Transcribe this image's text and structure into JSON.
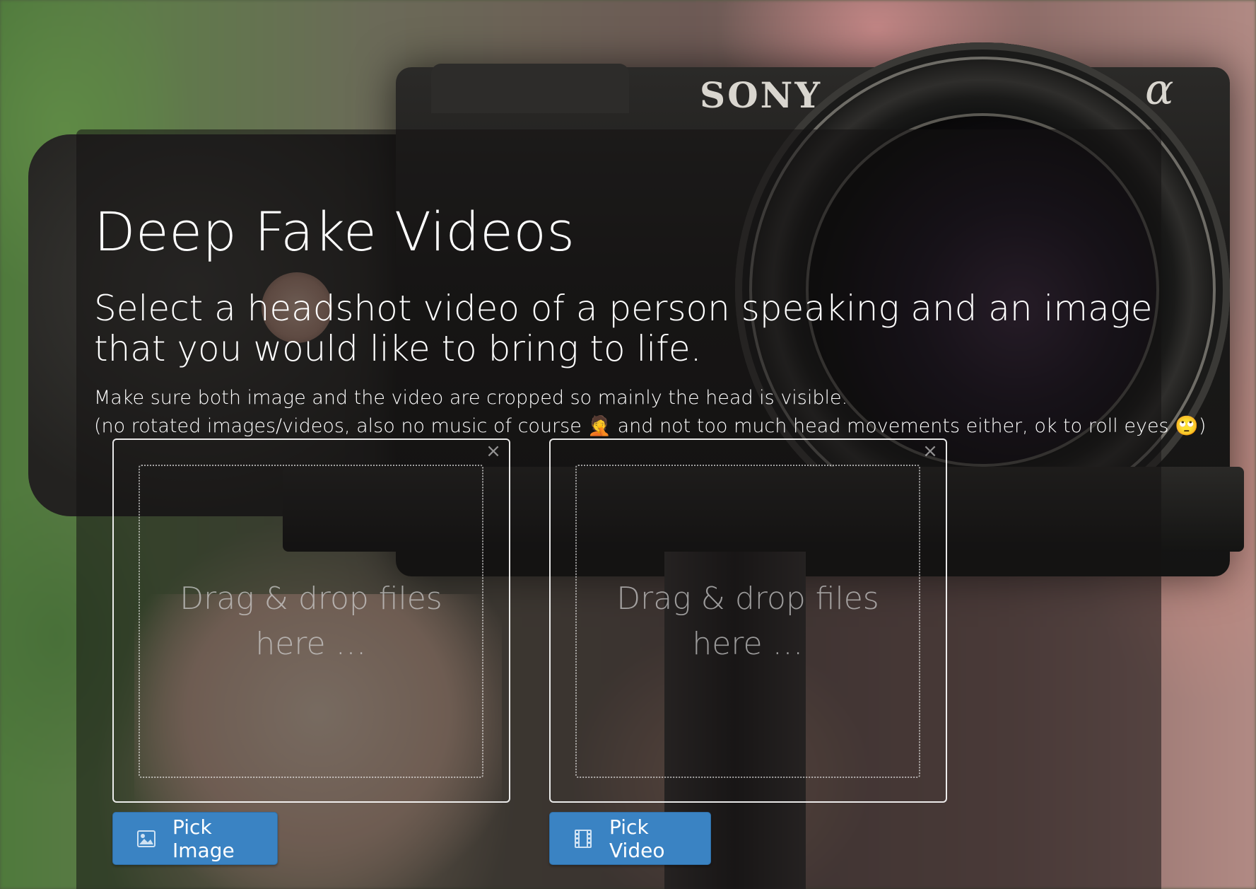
{
  "header": {
    "title": "Deep Fake Videos",
    "subtitle": "Select a headshot video of a person speaking and an image that you would like to bring to life.",
    "note_line1": "Make sure both image and the video are cropped so mainly the head is visible.",
    "note_line2_a": "(no rotated images/videos, also no music of course ",
    "note_line2_emoji1": "🤦",
    "note_line2_b": " and not too much head movements either, ok to roll eyes ",
    "note_line2_emoji2": "🙄",
    "note_line2_c": ")"
  },
  "background": {
    "brand_text": "SONY",
    "alpha_text": "α"
  },
  "image_upload": {
    "drop_text": "Drag & drop files here …",
    "close_glyph": "×",
    "button_label": "Pick Image",
    "button_icon": "image-icon"
  },
  "video_upload": {
    "drop_text": "Drag & drop files here …",
    "close_glyph": "×",
    "button_label": "Pick Video",
    "button_icon": "film-icon"
  },
  "colors": {
    "button_bg": "#3a83c3",
    "overlay": "rgba(20,18,18,0.55)"
  }
}
